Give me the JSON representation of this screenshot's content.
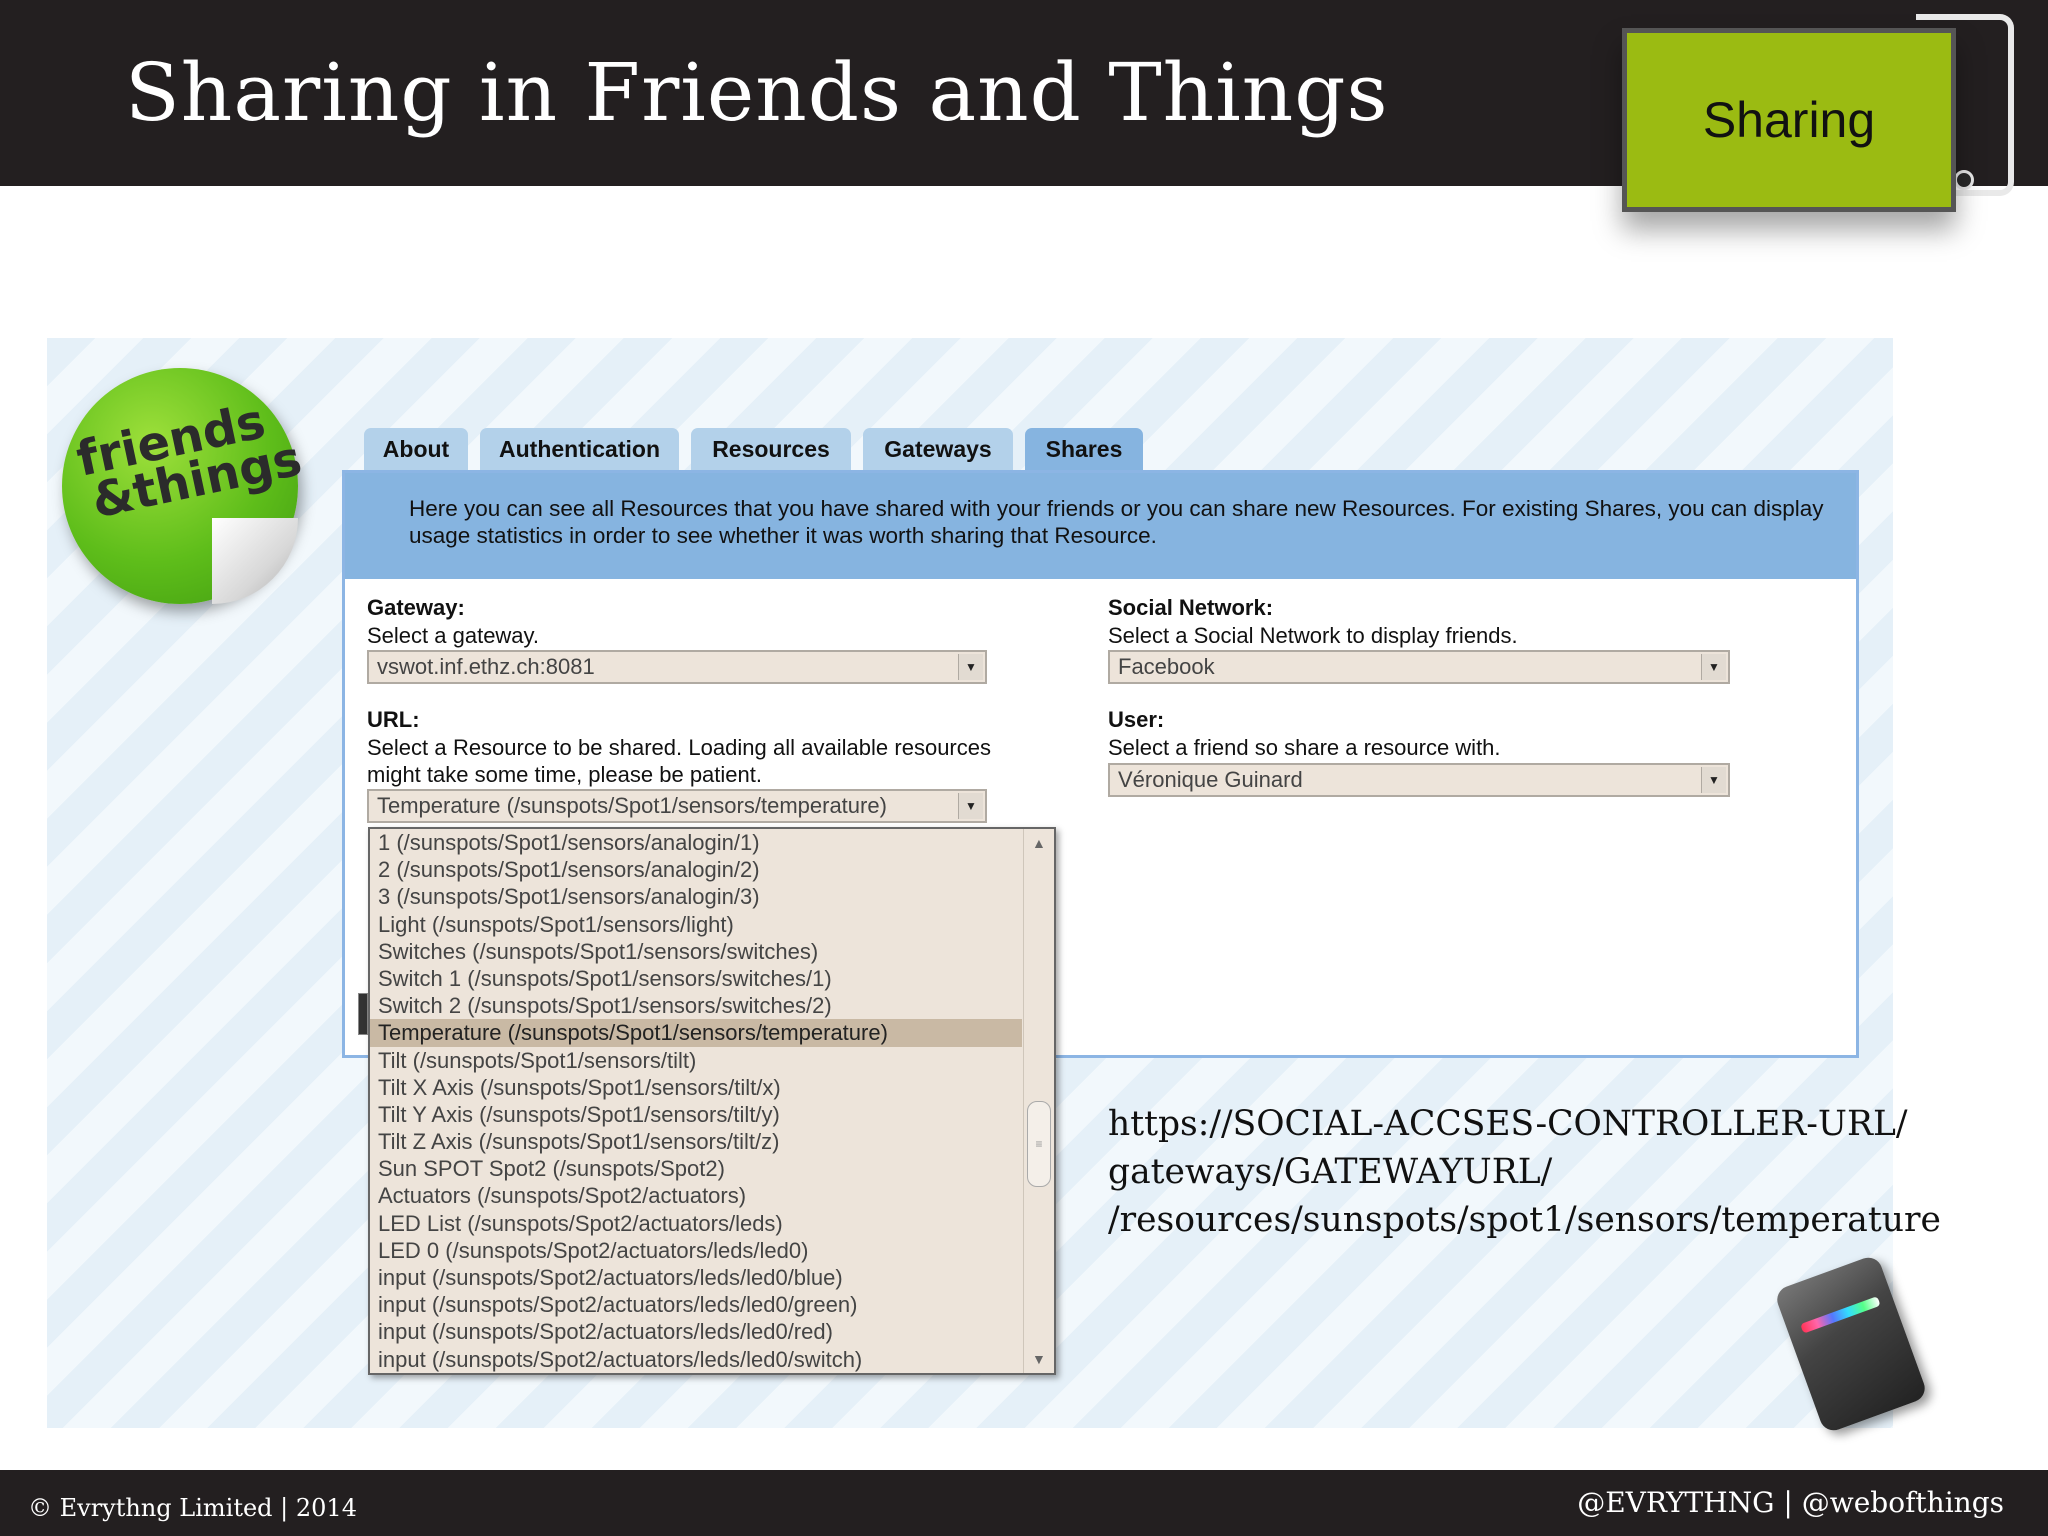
{
  "slide": {
    "title": "Sharing in Friends and Things",
    "badge": "Sharing",
    "footer_left": "© Evrythng Limited | 2014",
    "footer_right": "@EVRYTHNG | @webofthings"
  },
  "logo": {
    "line1": "friends",
    "line2": "&things"
  },
  "tabs": [
    {
      "label": "About"
    },
    {
      "label": "Authentication"
    },
    {
      "label": "Resources"
    },
    {
      "label": "Gateways"
    },
    {
      "label": "Shares",
      "active": true
    }
  ],
  "info": {
    "text": "Here you can see all Resources that you have shared with your friends or you can share new Resources. For existing Shares, you can display usage statistics in order to see whether it was worth sharing that Resource."
  },
  "form": {
    "gateway": {
      "label": "Gateway:",
      "help": "Select a gateway.",
      "value": "vswot.inf.ethz.ch:8081"
    },
    "url": {
      "label": "URL:",
      "help": "Select a Resource to be shared. Loading all available resources might take some time, please be patient.",
      "value": "Temperature (/sunspots/Spot1/sensors/temperature)"
    },
    "social_network": {
      "label": "Social Network:",
      "help": "Select a Social Network to display friends.",
      "value": "Facebook"
    },
    "user": {
      "label": "User:",
      "help": "Select a friend so share a resource with.",
      "value": "Véronique Guinard"
    }
  },
  "dropdown": {
    "items": [
      "1 (/sunspots/Spot1/sensors/analogin/1)",
      "2 (/sunspots/Spot1/sensors/analogin/2)",
      "3 (/sunspots/Spot1/sensors/analogin/3)",
      "Light (/sunspots/Spot1/sensors/light)",
      "Switches (/sunspots/Spot1/sensors/switches)",
      "Switch 1 (/sunspots/Spot1/sensors/switches/1)",
      "Switch 2 (/sunspots/Spot1/sensors/switches/2)",
      "Temperature (/sunspots/Spot1/sensors/temperature)",
      "Tilt (/sunspots/Spot1/sensors/tilt)",
      "Tilt X Axis (/sunspots/Spot1/sensors/tilt/x)",
      "Tilt Y Axis (/sunspots/Spot1/sensors/tilt/y)",
      "Tilt Z Axis (/sunspots/Spot1/sensors/tilt/z)",
      "Sun SPOT Spot2 (/sunspots/Spot2)",
      "Actuators (/sunspots/Spot2/actuators)",
      "LED List (/sunspots/Spot2/actuators/leds)",
      "LED 0 (/sunspots/Spot2/actuators/leds/led0)",
      "input (/sunspots/Spot2/actuators/leds/led0/blue)",
      "input (/sunspots/Spot2/actuators/leds/led0/green)",
      "input (/sunspots/Spot2/actuators/leds/led0/red)",
      "input (/sunspots/Spot2/actuators/leds/led0/switch)"
    ],
    "selected_index": 7
  },
  "url_pattern": {
    "line1": "https://SOCIAL-ACCSES-CONTROLLER-URL/",
    "line2": "gateways/GATEWAYURL/",
    "line3": "/resources/sunspots/spot1/sensors/temperature"
  },
  "icons": {
    "dropdown_arrow": "chevron-down-icon",
    "scroll_up": "arrow-up-icon",
    "scroll_down": "arrow-down-icon"
  },
  "colors": {
    "header_bg": "#231f20",
    "badge_green": "#9bbb12",
    "tab_blue": "#b3d1ea",
    "active_tab_blue": "#86b4e0",
    "select_bg": "#ede4da",
    "selected_item": "#c9b9a4"
  }
}
